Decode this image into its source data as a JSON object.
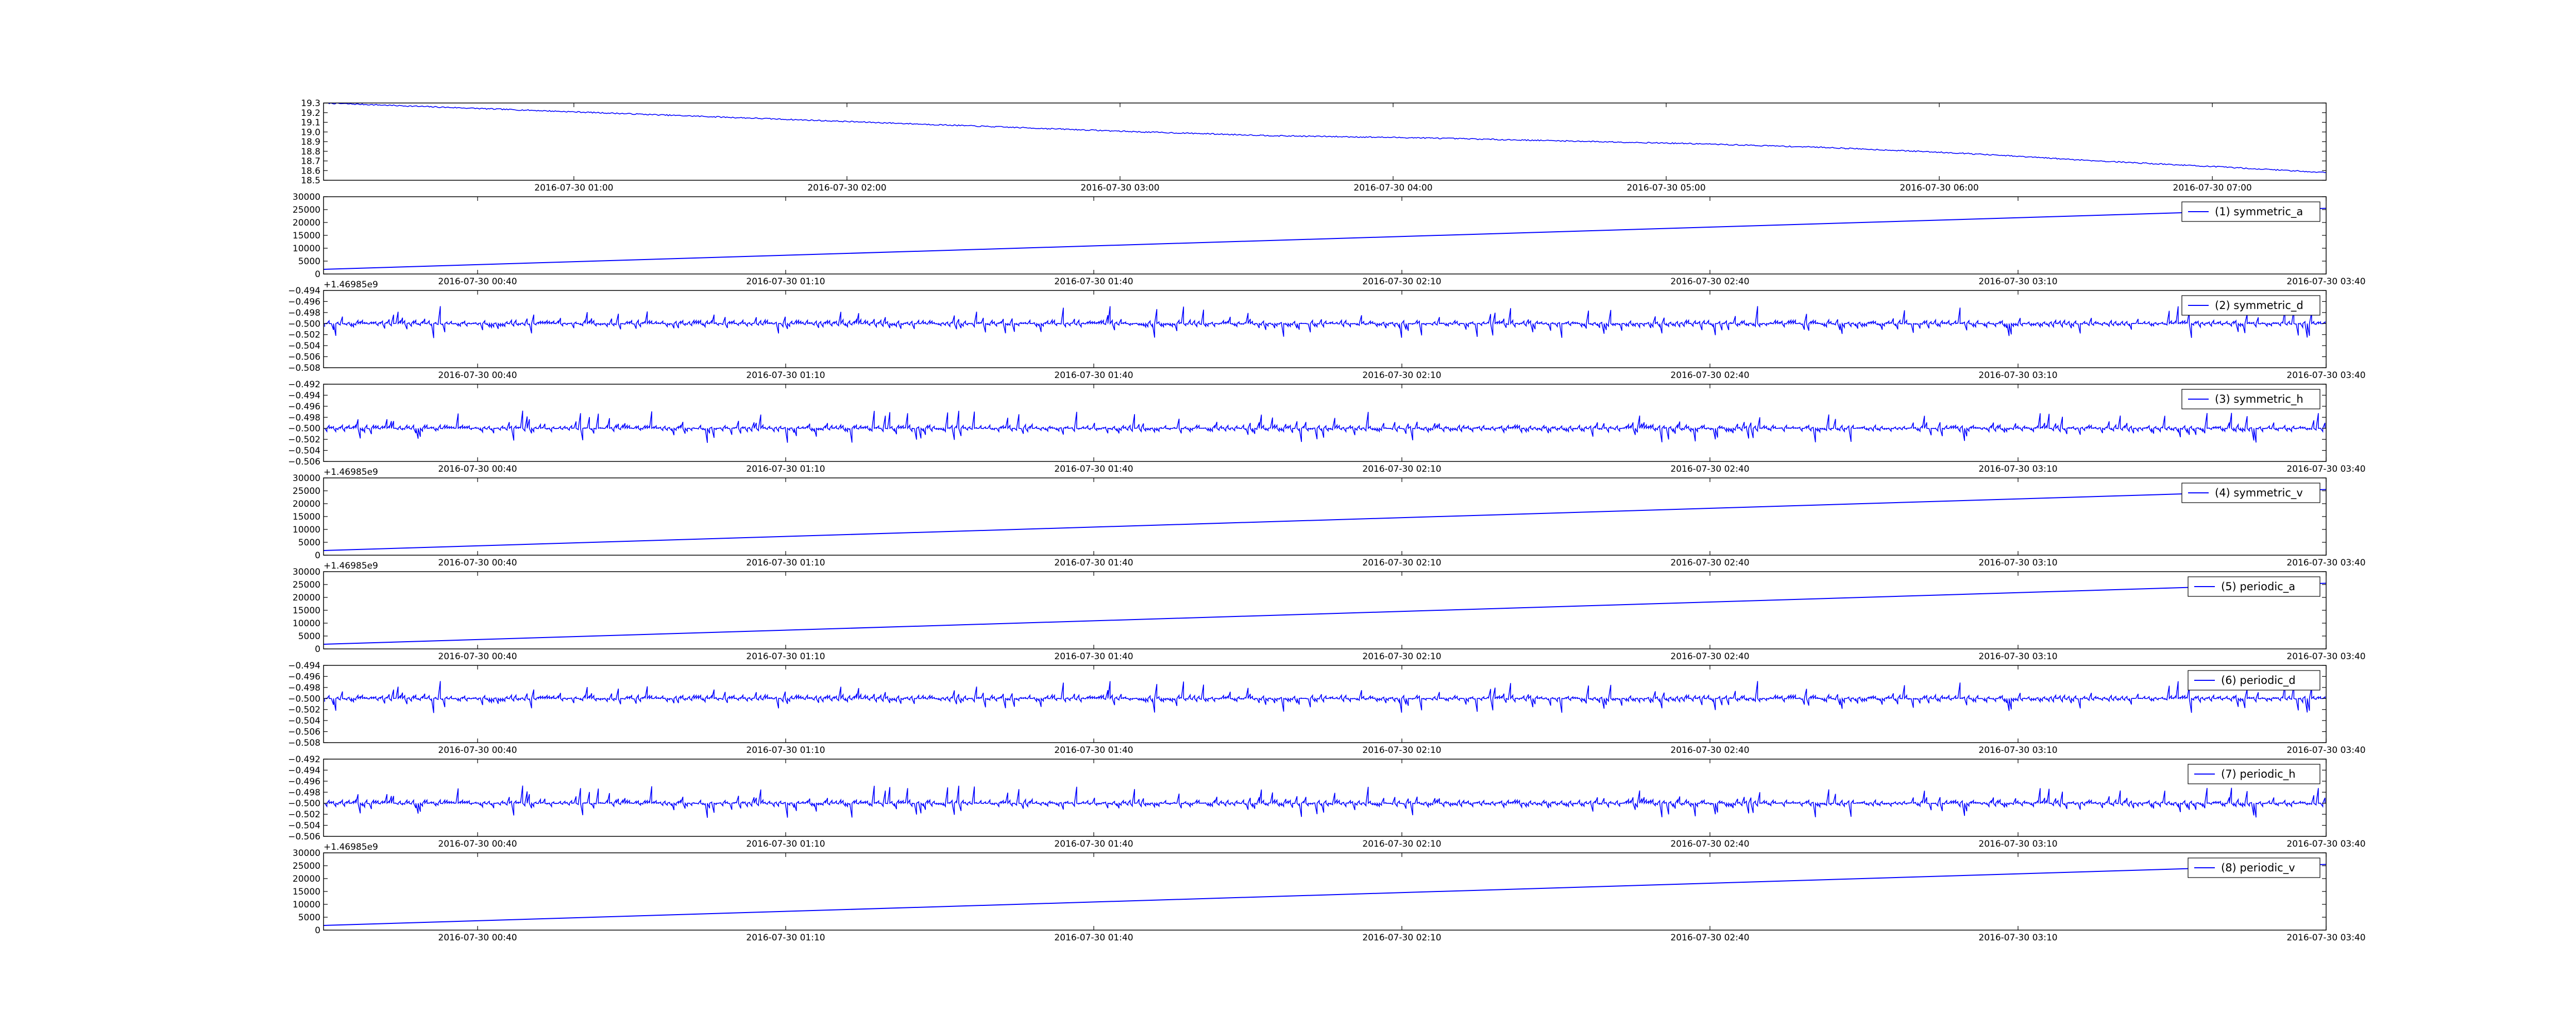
{
  "colors": {
    "line": "#0000ff",
    "axes": "#000000"
  },
  "chart_data": [
    {
      "type": "line",
      "title": "",
      "x": [
        "2016-07-30 00:05",
        "2016-07-30 00:35",
        "2016-07-30 01:05",
        "2016-07-30 01:35",
        "2016-07-30 02:05",
        "2016-07-30 02:35",
        "2016-07-30 03:05",
        "2016-07-30 03:35",
        "2016-07-30 04:05",
        "2016-07-30 04:35",
        "2016-07-30 05:05",
        "2016-07-30 05:35",
        "2016-07-30 06:05",
        "2016-07-30 06:35",
        "2016-07-30 07:05",
        "2016-07-30 07:25"
      ],
      "series": [
        {
          "values": [
            19.3,
            19.25,
            19.2,
            19.15,
            19.1,
            19.05,
            19.0,
            18.96,
            18.94,
            18.91,
            18.88,
            18.84,
            18.78,
            18.7,
            18.63,
            18.58
          ]
        }
      ],
      "xticks": [
        "2016-07-30 01:00",
        "2016-07-30 02:00",
        "2016-07-30 03:00",
        "2016-07-30 04:00",
        "2016-07-30 05:00",
        "2016-07-30 06:00",
        "2016-07-30 07:00"
      ],
      "yticks": [
        "19.3",
        "19.2",
        "19.1",
        "19.0",
        "18.9",
        "18.8",
        "18.7",
        "18.6",
        "18.5"
      ],
      "ylim": [
        18.5,
        19.3
      ],
      "offset_text": "",
      "legend": "",
      "grid": false
    },
    {
      "type": "line",
      "x": [
        "2016-07-30 00:25",
        "2016-07-30 03:40"
      ],
      "series": [
        {
          "name": "(1) symmetric_a",
          "values": [
            1800,
            25500
          ]
        }
      ],
      "xticks": [
        "2016-07-30 00:40",
        "2016-07-30 01:10",
        "2016-07-30 01:40",
        "2016-07-30 02:10",
        "2016-07-30 02:40",
        "2016-07-30 03:10",
        "2016-07-30 03:40"
      ],
      "yticks": [
        "30000",
        "25000",
        "20000",
        "15000",
        "10000",
        "5000",
        "0"
      ],
      "ylim": [
        0,
        30000
      ],
      "offset_text": "+1.46985e9",
      "legend": "top-right",
      "grid": false
    },
    {
      "type": "bar",
      "baseline": -0.5,
      "pattern": "noise-d",
      "xrange": [
        "2016-07-30 00:25",
        "2016-07-30 03:40"
      ],
      "series": [
        {
          "name": "(2) symmetric_d"
        }
      ],
      "xticks": [
        "2016-07-30 00:40",
        "2016-07-30 01:10",
        "2016-07-30 01:40",
        "2016-07-30 02:10",
        "2016-07-30 02:40",
        "2016-07-30 03:10",
        "2016-07-30 03:40"
      ],
      "yticks": [
        "−0.494",
        "−0.496",
        "−0.498",
        "−0.500",
        "−0.502",
        "−0.504",
        "−0.506",
        "−0.508"
      ],
      "ylim": [
        -0.508,
        -0.494
      ],
      "offset_text": "",
      "legend": "top-right",
      "grid": false
    },
    {
      "type": "bar",
      "baseline": -0.5,
      "pattern": "noise-h",
      "xrange": [
        "2016-07-30 00:25",
        "2016-07-30 03:40"
      ],
      "series": [
        {
          "name": "(3) symmetric_h"
        }
      ],
      "xticks": [
        "2016-07-30 00:40",
        "2016-07-30 01:10",
        "2016-07-30 01:40",
        "2016-07-30 02:10",
        "2016-07-30 02:40",
        "2016-07-30 03:10",
        "2016-07-30 03:40"
      ],
      "yticks": [
        "−0.492",
        "−0.494",
        "−0.496",
        "−0.498",
        "−0.500",
        "−0.502",
        "−0.504",
        "−0.506"
      ],
      "ylim": [
        -0.506,
        -0.492
      ],
      "offset_text": "+1.46985e9",
      "legend": "top-right",
      "grid": false
    },
    {
      "type": "line",
      "x": [
        "2016-07-30 00:25",
        "2016-07-30 03:40"
      ],
      "series": [
        {
          "name": "(4) symmetric_v",
          "values": [
            1800,
            25500
          ]
        }
      ],
      "xticks": [
        "2016-07-30 00:40",
        "2016-07-30 01:10",
        "2016-07-30 01:40",
        "2016-07-30 02:10",
        "2016-07-30 02:40",
        "2016-07-30 03:10",
        "2016-07-30 03:40"
      ],
      "yticks": [
        "30000",
        "25000",
        "20000",
        "15000",
        "10000",
        "5000",
        "0"
      ],
      "ylim": [
        0,
        30000
      ],
      "offset_text": "+1.46985e9",
      "legend": "top-right",
      "grid": false
    },
    {
      "type": "line",
      "x": [
        "2016-07-30 00:25",
        "2016-07-30 03:40"
      ],
      "series": [
        {
          "name": "(5) periodic_a",
          "values": [
            1800,
            25500
          ]
        }
      ],
      "xticks": [
        "2016-07-30 00:40",
        "2016-07-30 01:10",
        "2016-07-30 01:40",
        "2016-07-30 02:10",
        "2016-07-30 02:40",
        "2016-07-30 03:10",
        "2016-07-30 03:40"
      ],
      "yticks": [
        "30000",
        "25000",
        "20000",
        "15000",
        "10000",
        "5000",
        "0"
      ],
      "ylim": [
        0,
        30000
      ],
      "offset_text": "",
      "legend": "top-right",
      "grid": false
    },
    {
      "type": "bar",
      "baseline": -0.5,
      "pattern": "noise-d",
      "xrange": [
        "2016-07-30 00:25",
        "2016-07-30 03:40"
      ],
      "series": [
        {
          "name": "(6) periodic_d"
        }
      ],
      "xticks": [
        "2016-07-30 00:40",
        "2016-07-30 01:10",
        "2016-07-30 01:40",
        "2016-07-30 02:10",
        "2016-07-30 02:40",
        "2016-07-30 03:10",
        "2016-07-30 03:40"
      ],
      "yticks": [
        "−0.494",
        "−0.496",
        "−0.498",
        "−0.500",
        "−0.502",
        "−0.504",
        "−0.506",
        "−0.508"
      ],
      "ylim": [
        -0.508,
        -0.494
      ],
      "offset_text": "",
      "legend": "top-right",
      "grid": false
    },
    {
      "type": "bar",
      "baseline": -0.5,
      "pattern": "noise-h",
      "xrange": [
        "2016-07-30 00:25",
        "2016-07-30 03:40"
      ],
      "series": [
        {
          "name": "(7) periodic_h"
        }
      ],
      "xticks": [
        "2016-07-30 00:40",
        "2016-07-30 01:10",
        "2016-07-30 01:40",
        "2016-07-30 02:10",
        "2016-07-30 02:40",
        "2016-07-30 03:10",
        "2016-07-30 03:40"
      ],
      "yticks": [
        "−0.492",
        "−0.494",
        "−0.496",
        "−0.498",
        "−0.500",
        "−0.502",
        "−0.504",
        "−0.506"
      ],
      "ylim": [
        -0.506,
        -0.492
      ],
      "offset_text": "+1.46985e9",
      "legend": "top-right",
      "grid": false
    },
    {
      "type": "line",
      "x": [
        "2016-07-30 00:25",
        "2016-07-30 03:40"
      ],
      "series": [
        {
          "name": "(8) periodic_v",
          "values": [
            1800,
            25500
          ]
        }
      ],
      "xticks": [
        "2016-07-30 00:40",
        "2016-07-30 01:10",
        "2016-07-30 01:40",
        "2016-07-30 02:10",
        "2016-07-30 02:40",
        "2016-07-30 03:10",
        "2016-07-30 03:40"
      ],
      "yticks": [
        "30000",
        "25000",
        "20000",
        "15000",
        "10000",
        "5000",
        "0"
      ],
      "ylim": [
        0,
        30000
      ],
      "offset_text": "",
      "legend": "top-right",
      "grid": false
    }
  ]
}
